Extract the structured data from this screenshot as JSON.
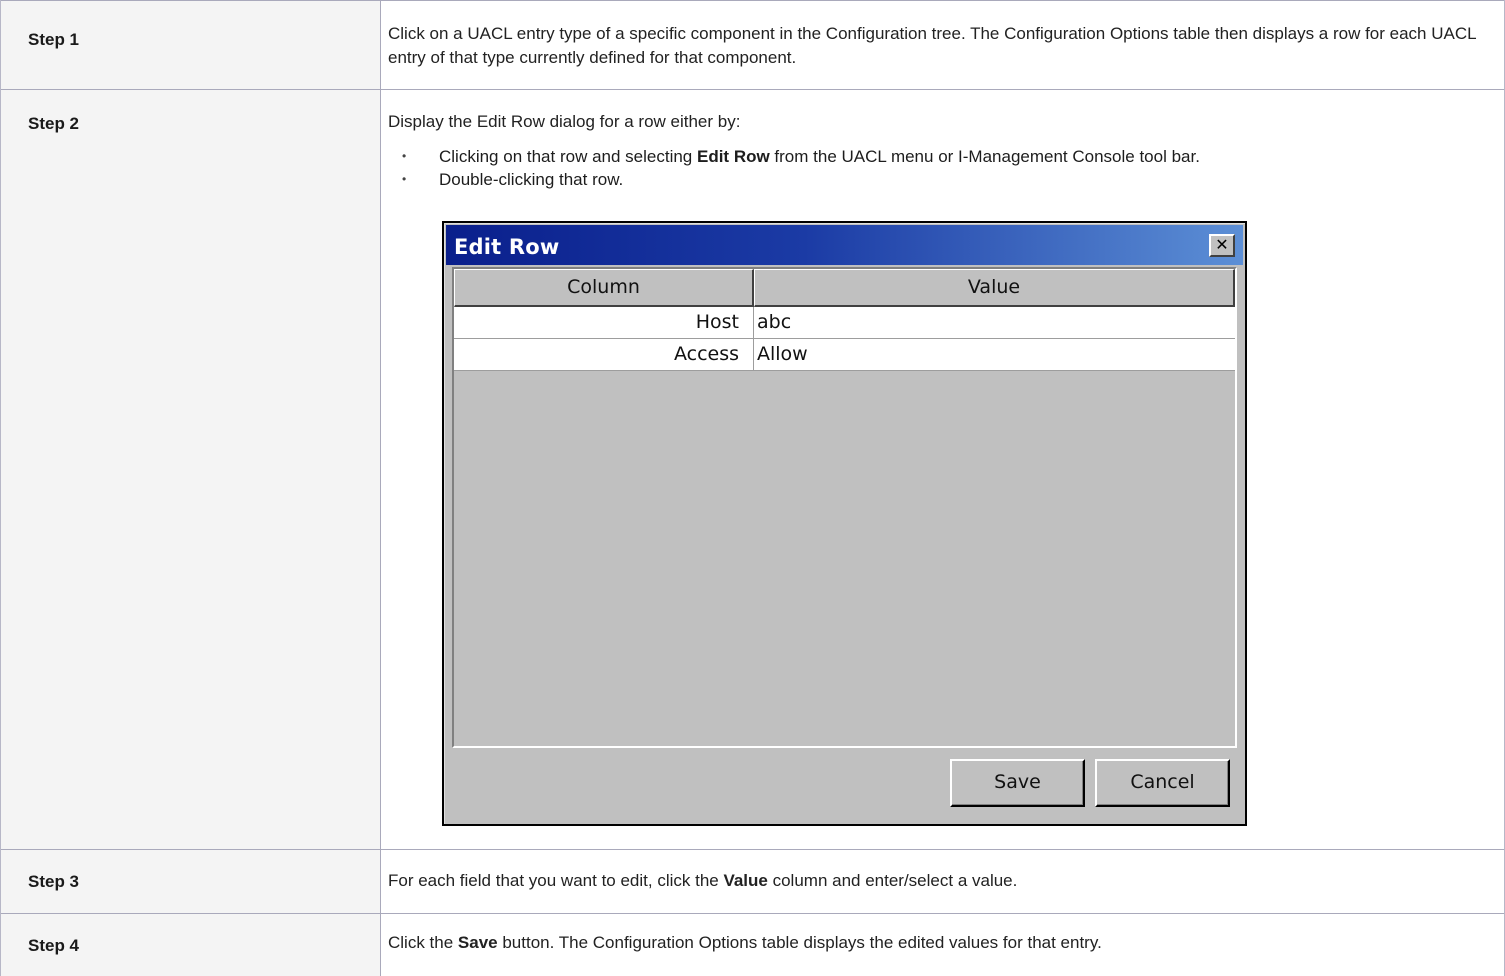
{
  "steps": [
    {
      "label": "Step 1",
      "text": "Click on a UACL entry type of a specific component in the Configuration tree. The Configuration Options table then displays a row for each UACL entry of that type currently defined for that component."
    },
    {
      "label": "Step 2",
      "intro": "Display the Edit Row dialog for a row either by:",
      "bullet1_pre": "Clicking on that row and selecting ",
      "bullet1_bold": "Edit Row",
      "bullet1_post": " from the UACL menu or I-Management Console tool bar.",
      "bullet2": "Double-clicking that row."
    },
    {
      "label": "Step 3",
      "text_pre": "For each field that you want to edit, click the ",
      "text_bold": "Value",
      "text_post": " column and enter/select a value."
    },
    {
      "label": "Step 4",
      "text_pre": "Click the ",
      "text_bold": "Save",
      "text_post": " button. The Configuration Options table displays the edited values for that entry."
    }
  ],
  "dialog": {
    "title": "Edit Row",
    "close_glyph": "✕",
    "headers": [
      "Column",
      "Value"
    ],
    "rows": [
      {
        "column": "Host",
        "value": "abc"
      },
      {
        "column": "Access",
        "value": "Allow"
      }
    ],
    "save_label": "Save",
    "cancel_label": "Cancel"
  }
}
